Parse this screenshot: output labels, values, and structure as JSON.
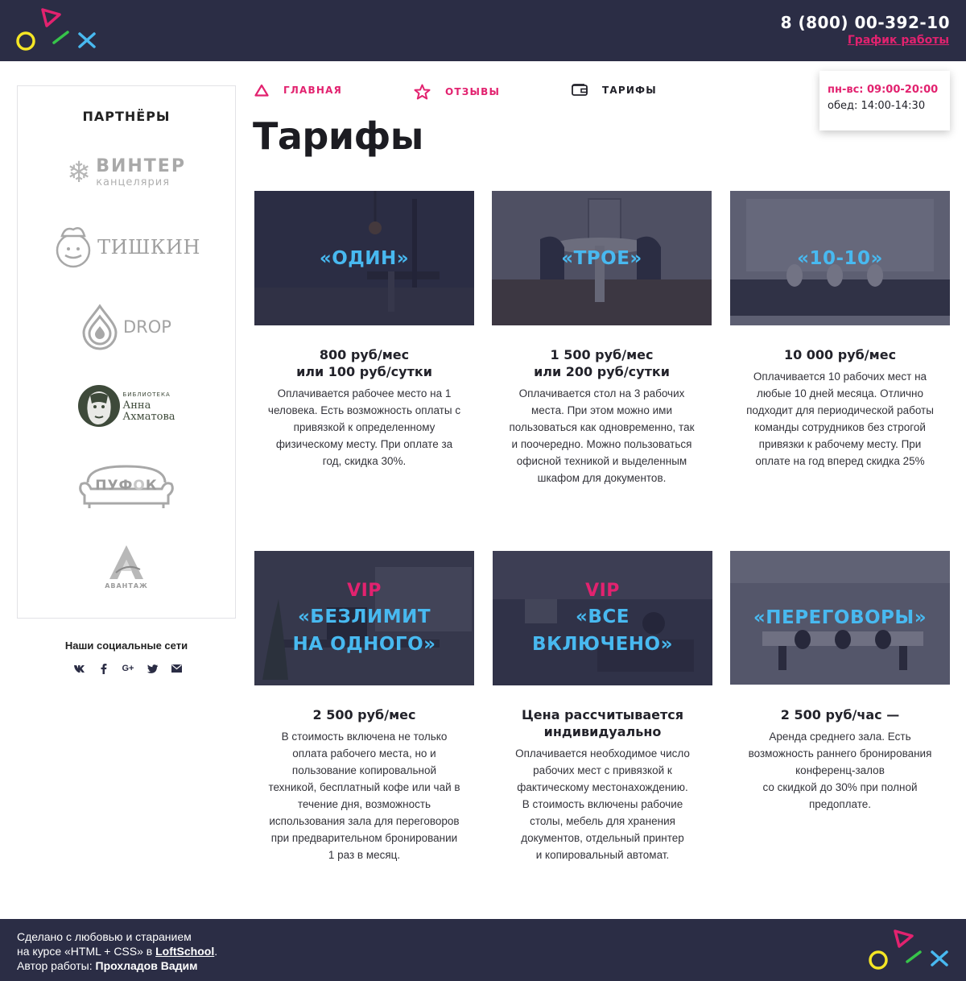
{
  "header": {
    "phone": "8 (800) 00-392-10",
    "schedule_link": "График работы",
    "logo": "logo-shapes"
  },
  "nav": {
    "items": [
      {
        "label": "ГЛАВНАЯ",
        "icon": "triangle-icon"
      },
      {
        "label": "ОТЗЫВЫ",
        "icon": "star-icon"
      },
      {
        "label": "ТАРИФЫ",
        "icon": "wallet-icon"
      }
    ]
  },
  "hours": {
    "line1": "пн-вс: 09:00-20:00",
    "line2": "обед: 14:00-14:30"
  },
  "page_title": "Тарифы",
  "sidebar": {
    "partners_title": "ПАРТНЁРЫ",
    "partners": [
      {
        "name": "ВИНТЕР",
        "sub": "канцелярия"
      },
      {
        "name": "ТИШКИН"
      },
      {
        "name": "DROP"
      },
      {
        "name_small": "БИБЛИОТЕКА",
        "name1": "Анна",
        "name2": "Ахматова"
      },
      {
        "name_a": "ПУФ",
        "name_b": "О",
        "name_c": "К"
      },
      {
        "name": "АВАНТАЖ"
      }
    ],
    "social_title": "Наши социальные сети",
    "socials": [
      {
        "label": "vk",
        "icon": "vk-icon"
      },
      {
        "label": "f",
        "icon": "facebook-icon"
      },
      {
        "label": "G+",
        "icon": "google-plus-icon"
      },
      {
        "label": "twitter",
        "icon": "twitter-icon"
      },
      {
        "label": "mail",
        "icon": "mail-icon"
      }
    ]
  },
  "cards": [
    {
      "vip": "",
      "name": "«ОДИН»",
      "price1": "800 руб/мес",
      "price2": "или 100 руб/сутки",
      "desc": [
        "Оплачивается рабочее место на 1",
        "человека. Есть возможность оплаты с",
        "привязкой к определенному",
        "физическому месту. При оплате за",
        "год, скидка 30%."
      ]
    },
    {
      "vip": "",
      "name": "«ТРОЕ»",
      "price1": "1 500 руб/мес",
      "price2": "или 200 руб/сутки",
      "desc": [
        "Оплачивается стол на 3 рабочих",
        "места. При этом можно ими",
        "пользоваться как одновременно, так",
        "и поочередно. Можно пользоваться",
        "офисной техникой и выделенным",
        "шкафом для документов."
      ]
    },
    {
      "vip": "",
      "name": "«10-10»",
      "price1": "10 000 руб/мес",
      "price2": "",
      "desc": [
        "Оплачивается 10 рабочих мест на",
        "любые 10 дней месяца. Отлично",
        "подходит для периодической работы",
        "команды сотрудников без строгой",
        "привязки к рабочему месту. При",
        "оплате на год вперед скидка 25%"
      ]
    },
    {
      "vip": "VIP",
      "name1": "«БЕЗЛИМИТ",
      "name2": "НА ОДНОГО»",
      "price1": "2 500 руб/мес",
      "price2": "",
      "desc": [
        "В стоимость включена не только",
        "оплата рабочего места, но и",
        "пользование копировальной",
        "техникой, бесплатный кофе или чай в",
        "течение дня, возможность",
        "использования зала для переговоров",
        "при предварительном бронировании",
        "1 раз в месяц."
      ]
    },
    {
      "vip": "VIP",
      "name1": "«ВСЕ",
      "name2": "ВКЛЮЧЕНО»",
      "price1": "Цена рассчитывается",
      "price2": "индивидуально",
      "desc": [
        "Оплачивается необходимое число",
        "рабочих мест с привязкой к",
        "фактическому местонахождению.",
        "В стоимость включены рабочие",
        "столы, мебель для хранения",
        "документов, отдельный принтер",
        "и копировальный автомат."
      ]
    },
    {
      "vip": "",
      "name": "«ПЕРЕГОВОРЫ»",
      "price1": "2 500 руб/час —",
      "price2": "",
      "desc": [
        "Аренда среднего зала. Есть",
        "возможность раннего бронирования",
        "конференц-залов",
        "со скидкой до 30% при полной",
        "предоплате."
      ]
    }
  ],
  "footer": {
    "line1": "Сделано с любовью и старанием",
    "line2_a": "на курсе «HTML + CSS» в ",
    "line2_link": "LoftSchool",
    "line2_b": ".",
    "line3_a": "Автор работы: ",
    "line3_b": "Прохладов Вадим"
  },
  "colors": {
    "header_bg": "#2b2d45",
    "accent_pink": "#e2226f",
    "accent_blue": "#48b9f0",
    "logo_yellow": "#f5e625",
    "logo_green": "#37c44a"
  }
}
